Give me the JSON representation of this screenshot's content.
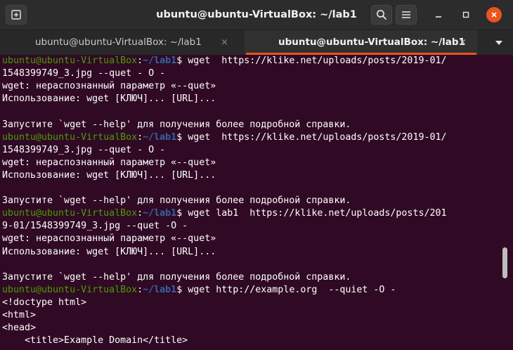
{
  "window": {
    "title": "ubuntu@ubuntu-VirtualBox: ~/lab1"
  },
  "header": {
    "new_tab_icon": "new-tab-icon",
    "search_icon": "search-icon",
    "menu_icon": "hamburger-menu-icon",
    "minimize_icon": "minimize-icon",
    "maximize_icon": "maximize-icon",
    "close_icon": "close-icon"
  },
  "tabs": [
    {
      "label": "ubuntu@ubuntu-VirtualBox: ~/lab1",
      "close": "×",
      "active": false
    },
    {
      "label": "ubuntu@ubuntu-VirtualBox: ~/lab1",
      "close": "×",
      "active": true
    }
  ],
  "colors": {
    "terminal_bg": "#300a24",
    "prompt_user": "#4e9a06",
    "prompt_path": "#3465a4",
    "accent": "#e95420"
  },
  "terminal": {
    "lines": [
      {
        "user": "ubuntu@ubuntu-VirtualBox",
        "sep": ":",
        "path": "~/lab1",
        "sym": "$",
        "cmd": " wget  https://klike.net/uploads/posts/2019-01/"
      },
      {
        "text": "1548399749_3.jpg --quet - O -"
      },
      {
        "text": "wget: нераспознанный параметр «--quet»"
      },
      {
        "text": "Использование: wget [КЛЮЧ]... [URL]..."
      },
      {
        "text": ""
      },
      {
        "text": "Запустите `wget --help' для получения более подробной справки."
      },
      {
        "user": "ubuntu@ubuntu-VirtualBox",
        "sep": ":",
        "path": "~/lab1",
        "sym": "$",
        "cmd": " wget  https://klike.net/uploads/posts/2019-01/"
      },
      {
        "text": "1548399749_3.jpg --quet - O -"
      },
      {
        "text": "wget: нераспознанный параметр «--quet»"
      },
      {
        "text": "Использование: wget [КЛЮЧ]... [URL]..."
      },
      {
        "text": ""
      },
      {
        "text": "Запустите `wget --help' для получения более подробной справки."
      },
      {
        "user": "ubuntu@ubuntu-VirtualBox",
        "sep": ":",
        "path": "~/lab1",
        "sym": "$",
        "cmd": " wget lab1  https://klike.net/uploads/posts/201"
      },
      {
        "text": "9-01/1548399749_3.jpg --quet -O -"
      },
      {
        "text": "wget: нераспознанный параметр «--quet»"
      },
      {
        "text": "Использование: wget [КЛЮЧ]... [URL]..."
      },
      {
        "text": ""
      },
      {
        "text": "Запустите `wget --help' для получения более подробной справки."
      },
      {
        "user": "ubuntu@ubuntu-VirtualBox",
        "sep": ":",
        "path": "~/lab1",
        "sym": "$",
        "cmd": " wget http://example.org  --quiet -O -"
      },
      {
        "text": "<!doctype html>"
      },
      {
        "text": "<html>"
      },
      {
        "text": "<head>"
      },
      {
        "text": "    <title>Example Domain</title>"
      }
    ]
  }
}
